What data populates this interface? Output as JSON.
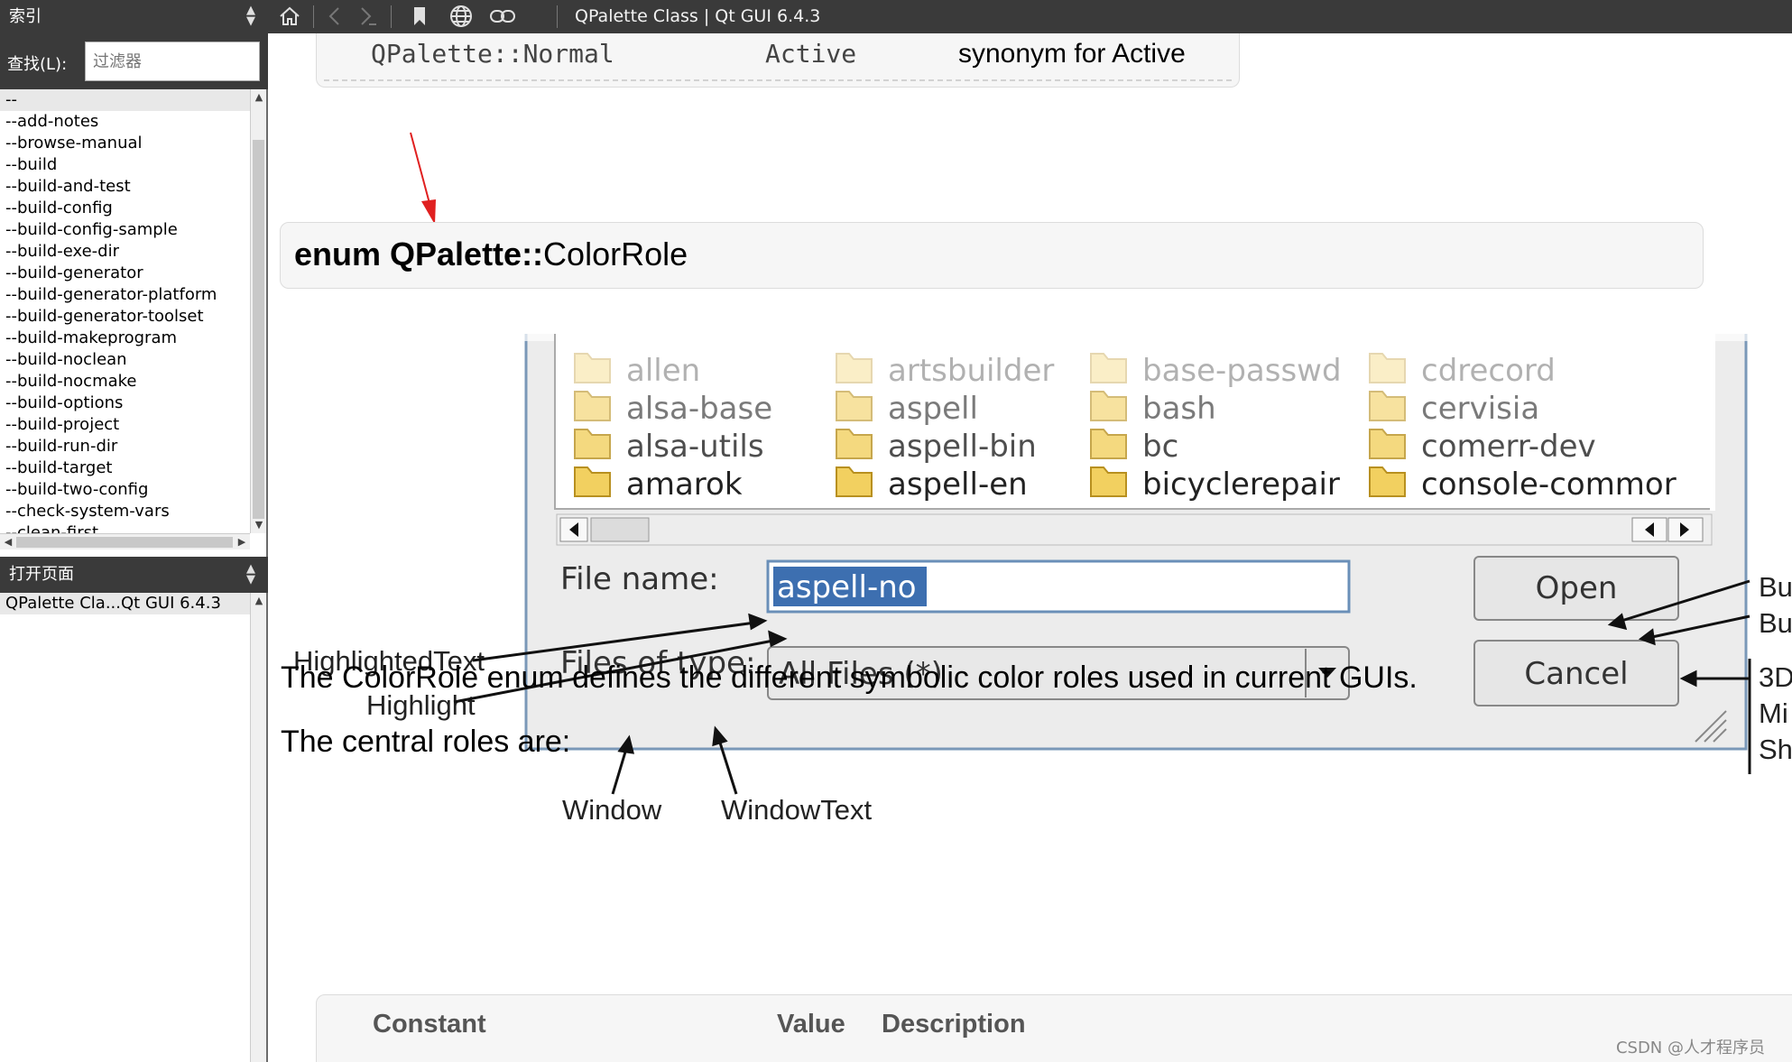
{
  "left_panel": {
    "index_header": "索引",
    "find_label": "查找(L):",
    "filter_placeholder": "过滤器",
    "index_items": [
      "--",
      "--add-notes",
      "--browse-manual",
      "--build",
      "--build-and-test",
      "--build-config",
      "--build-config-sample",
      "--build-exe-dir",
      "--build-generator",
      "--build-generator-platform",
      "--build-generator-toolset",
      "--build-makeprogram",
      "--build-noclean",
      "--build-nocmake",
      "--build-options",
      "--build-project",
      "--build-run-dir",
      "--build-target",
      "--build-two-config",
      "--check-system-vars",
      "--clean-first"
    ],
    "open_pages_header": "打开页面",
    "open_pages": [
      "QPalette Cla...Qt GUI 6.4.3"
    ]
  },
  "toolbar": {
    "icons": [
      "home-icon",
      "back-icon",
      "forward-icon",
      "bookmark-icon",
      "globe-icon",
      "link-icon"
    ],
    "page_title": "QPalette Class | Qt GUI 6.4.3"
  },
  "content": {
    "prev_row": {
      "constant": "QPalette::Normal",
      "value": "Active",
      "description": "synonym for Active"
    },
    "enum_title_bold": "enum QPalette::",
    "enum_title_rest": "ColorRole",
    "figure": {
      "folders_row0": [
        "allen",
        "artsbuilder",
        "base-passwd",
        "cdrecord"
      ],
      "folders_row1": [
        "alsa-base",
        "aspell",
        "bash",
        "cervisia"
      ],
      "folders_row2": [
        "alsa-utils",
        "aspell-bin",
        "bc",
        "comerr-dev"
      ],
      "folders_row3": [
        "amarok",
        "aspell-en",
        "bicyclerepair",
        "console-commor"
      ],
      "file_name_label": "File name:",
      "file_name_value": "aspell-no",
      "files_of_type_label": "Files of type:",
      "files_of_type_value": "All Files (*)",
      "open_button": "Open",
      "cancel_button": "Cancel",
      "callouts": {
        "highlighted_text": "HighlightedText",
        "highlight": "Highlight",
        "window": "Window",
        "window_text": "WindowText",
        "right_1": "Bu",
        "right_2": "Bu",
        "right_3": "3D",
        "right_4": "Mi",
        "right_5": "Sh"
      }
    },
    "para1": "The ColorRole enum defines the different symbolic color roles used in current GUIs.",
    "para2": "The central roles are:",
    "table_headers": {
      "constant": "Constant",
      "value": "Value",
      "description": "Description"
    }
  },
  "watermark": "CSDN @人才程序员",
  "colors": {
    "dark_bar": "#3a3a3a",
    "highlight": "#3d6fb0",
    "arrow_red": "#e02020",
    "box_bg": "#f6f6f6"
  }
}
